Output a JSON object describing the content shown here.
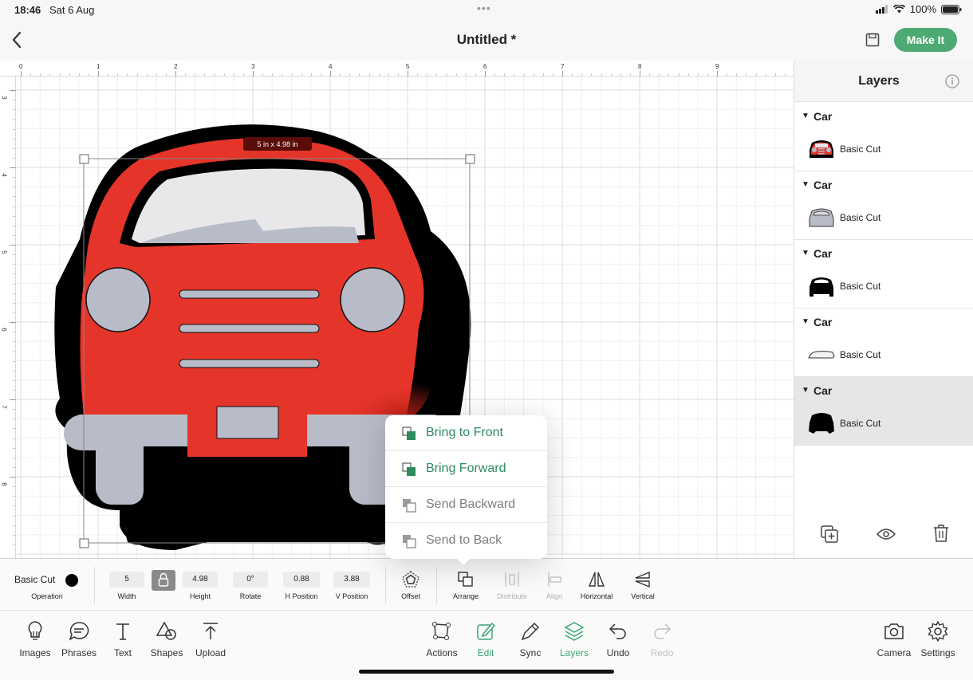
{
  "status": {
    "time": "18:46",
    "date": "Sat 6 Aug",
    "battery": "100%"
  },
  "header": {
    "title": "Untitled *",
    "make_it_label": "Make It"
  },
  "canvas": {
    "size_label": "5 in x 4.98 in",
    "ruler_top": [
      "0",
      "1",
      "2",
      "3",
      "4",
      "5",
      "6",
      "7",
      "8",
      "9",
      "1"
    ],
    "ruler_left": [
      "3",
      "4",
      "5",
      "6",
      "7",
      "8"
    ],
    "colors": {
      "car_body": "#e5352a",
      "car_outline": "#000000",
      "gray_part": "#b8bcc8",
      "window": "#e8e8ea"
    }
  },
  "layers": {
    "title": "Layers",
    "groups": [
      {
        "name": "Car",
        "operation": "Basic Cut",
        "thumb": "car-red-icon"
      },
      {
        "name": "Car",
        "operation": "Basic Cut",
        "thumb": "car-gray-icon"
      },
      {
        "name": "Car",
        "operation": "Basic Cut",
        "thumb": "car-black-icon"
      },
      {
        "name": "Car",
        "operation": "Basic Cut",
        "thumb": "car-window-icon"
      },
      {
        "name": "Car",
        "operation": "Basic Cut",
        "thumb": "car-black-icon"
      }
    ]
  },
  "edit_bar": {
    "operation_value": "Basic Cut",
    "operation_label": "Operation",
    "width_value": "5",
    "width_label": "Width",
    "height_value": "4.98",
    "height_label": "Height",
    "rotate_value": "0°",
    "rotate_label": "Rotate",
    "hpos_value": "0.88",
    "hpos_label": "H Position",
    "vpos_value": "3.88",
    "vpos_label": "V Position",
    "offset_label": "Offset",
    "arrange_label": "Arrange",
    "distribute_label": "Distribute",
    "align_label": "Align",
    "horizontal_label": "Horizontal",
    "vertical_label": "Vertical"
  },
  "arrange_menu": [
    {
      "label": "Bring to Front",
      "enabled": true
    },
    {
      "label": "Bring Forward",
      "enabled": true
    },
    {
      "label": "Send Backward",
      "enabled": false
    },
    {
      "label": "Send to Back",
      "enabled": false
    }
  ],
  "nav": {
    "images": "Images",
    "phrases": "Phrases",
    "text": "Text",
    "shapes": "Shapes",
    "upload": "Upload",
    "actions": "Actions",
    "edit": "Edit",
    "sync": "Sync",
    "layers": "Layers",
    "undo": "Undo",
    "redo": "Redo",
    "camera": "Camera",
    "settings": "Settings"
  },
  "accent_color": "#4eaa73"
}
